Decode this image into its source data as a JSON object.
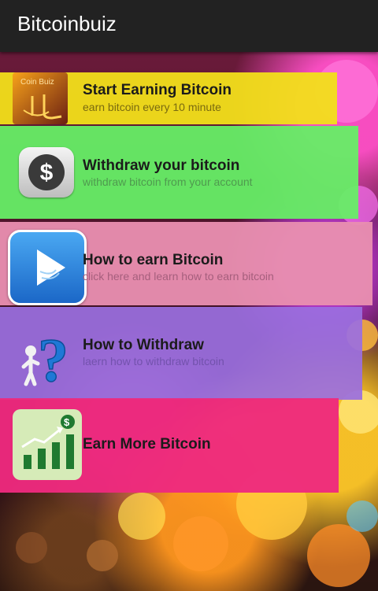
{
  "app": {
    "title": "Bitcoinbuiz"
  },
  "menu": [
    {
      "title": "Start Earning Bitcoin",
      "subtitle": "earn bitcoin every 10 minute",
      "color": "#f2df1a",
      "icon": "coin-buiz-logo-icon",
      "logo_text": "Coin Buiz"
    },
    {
      "title": "Withdraw your bitcoin",
      "subtitle": "withdraw bitcoin from your account",
      "color": "#66ee66",
      "icon": "dollar-coin-icon"
    },
    {
      "title": "How to earn Bitcoin",
      "subtitle": "click here and learn how to earn bitcoin",
      "color": "#e88fb0",
      "icon": "play-video-icon"
    },
    {
      "title": "How to Withdraw",
      "subtitle": "laern how to withdraw bitcoin",
      "color": "#9b6fe0",
      "icon": "question-mark-person-icon"
    },
    {
      "title": "Earn More Bitcoin",
      "subtitle": "",
      "color": "#ee2a7e",
      "icon": "growth-chart-icon"
    }
  ]
}
